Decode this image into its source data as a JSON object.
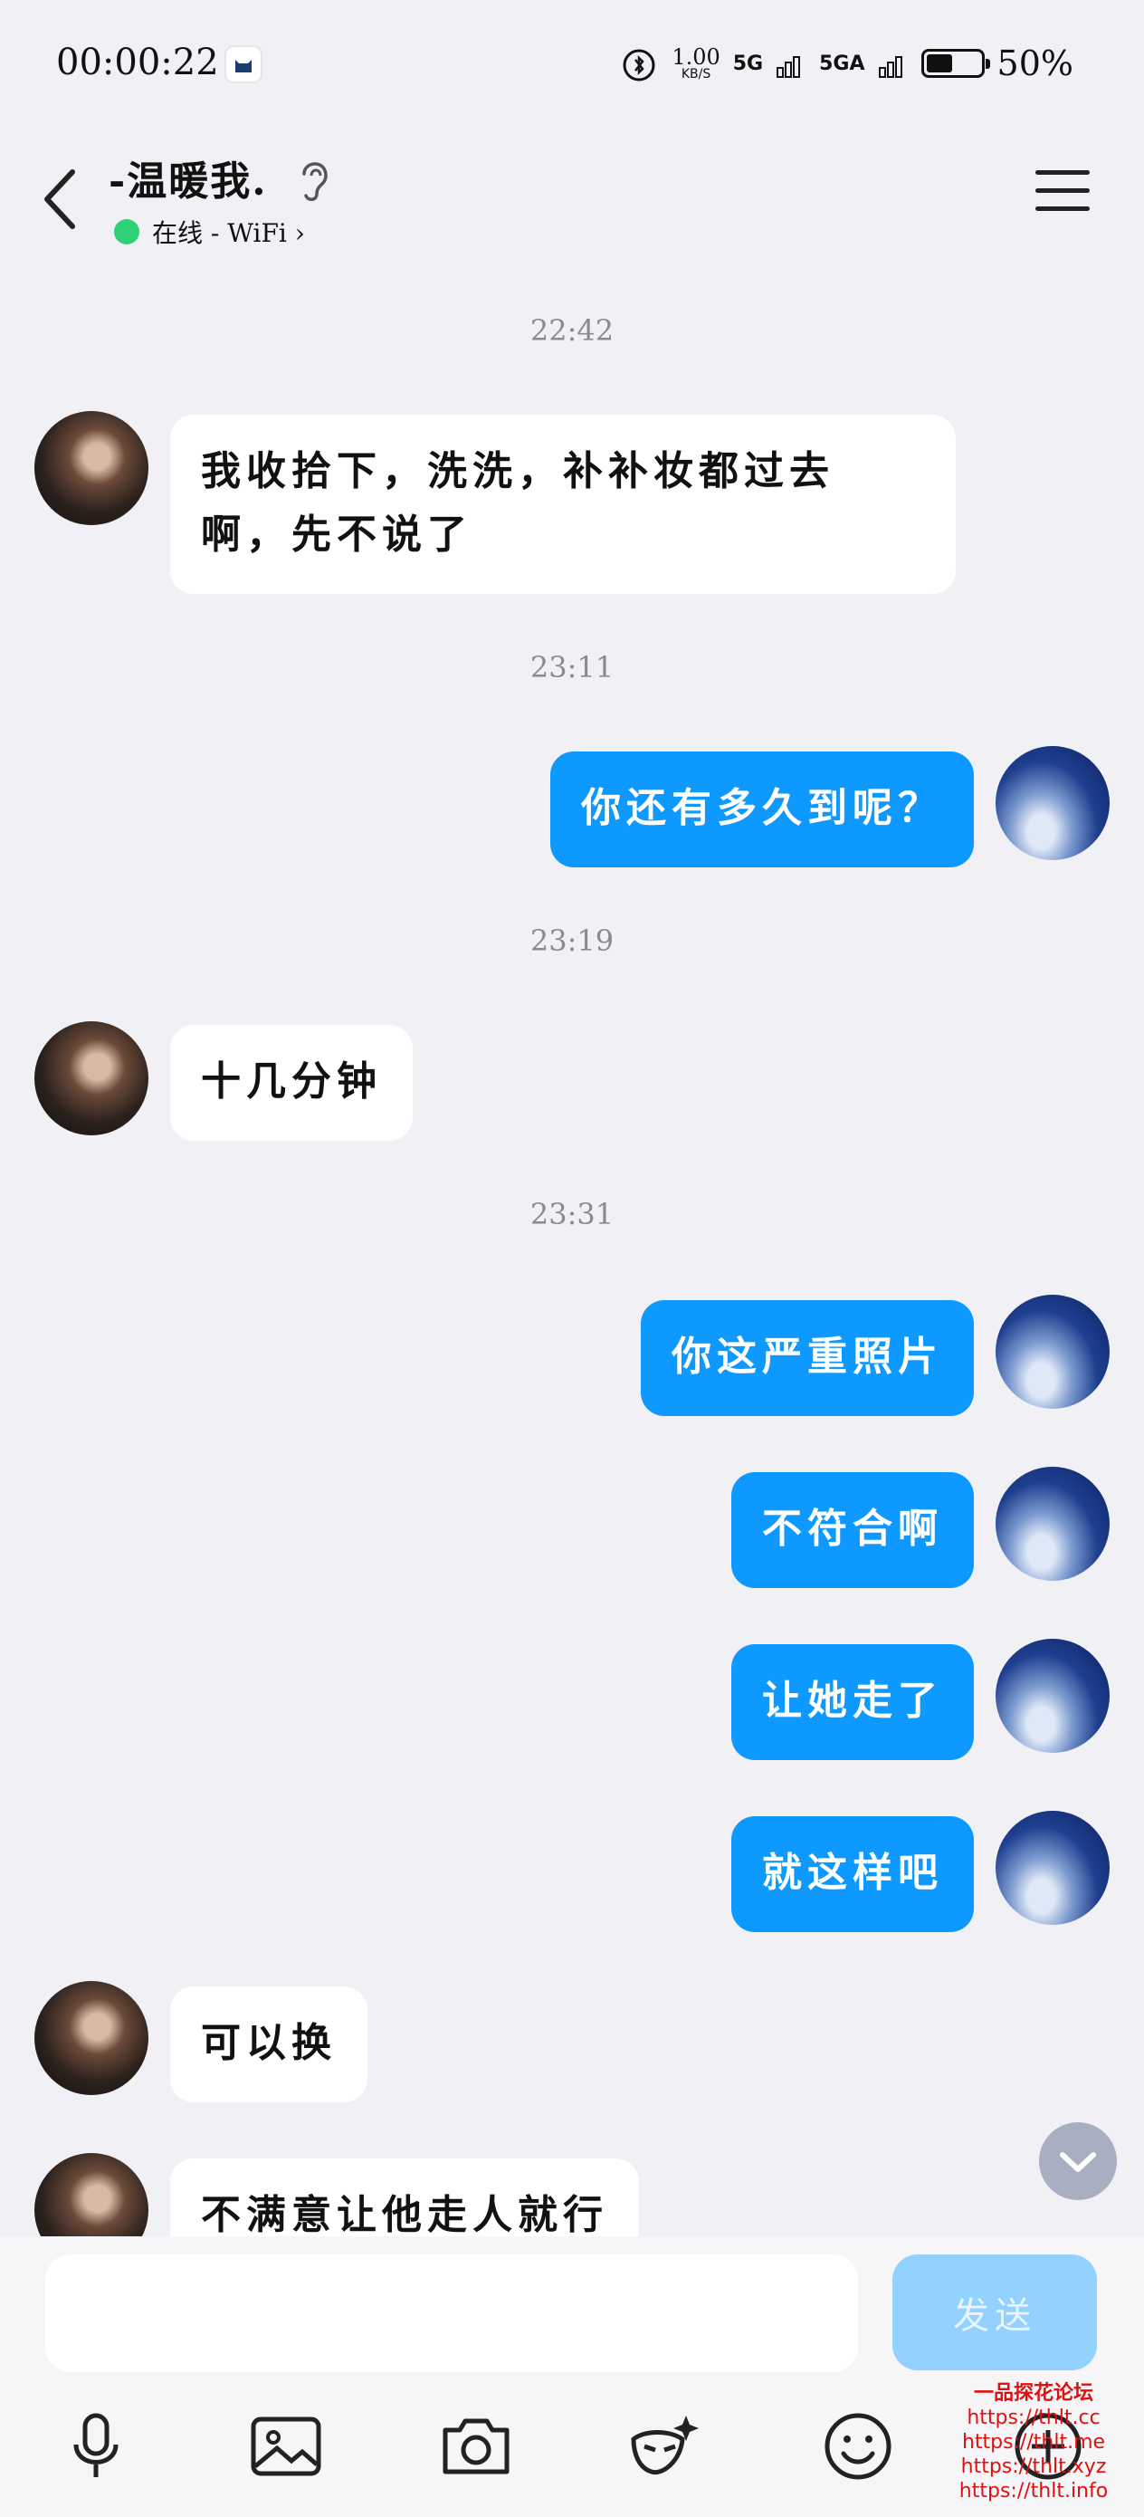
{
  "status_bar": {
    "time": "00:00:22",
    "speed_value": "1.00",
    "speed_unit": "KB/S",
    "net1": "5G",
    "net2": "5GA",
    "battery_pct": "50%",
    "battery_level": 0.5
  },
  "header": {
    "contact_name": "-温暖我.",
    "status": "在线 - WiFi",
    "status_color": "#2fd177"
  },
  "messages": [
    {
      "type": "time",
      "text": "22:42"
    },
    {
      "type": "in",
      "text": "我收拾下，洗洗，补补妆都过去"
    },
    {
      "type": "in_cont",
      "text": "啊，先不说了"
    },
    {
      "type": "time",
      "text": "23:11"
    },
    {
      "type": "out",
      "text": "你还有多久到呢？"
    },
    {
      "type": "time",
      "text": "23:19"
    },
    {
      "type": "in",
      "text": "十几分钟"
    },
    {
      "type": "time",
      "text": "23:31"
    },
    {
      "type": "out",
      "text": "你这严重照片"
    },
    {
      "type": "out",
      "text": "不符合啊"
    },
    {
      "type": "out",
      "text": "让她走了"
    },
    {
      "type": "out",
      "text": "就这样吧"
    },
    {
      "type": "in",
      "text": "可以换"
    },
    {
      "type": "in",
      "text": "不满意让他走人就行"
    }
  ],
  "input": {
    "placeholder": "",
    "send_label": "发送"
  },
  "colors": {
    "outgoing_bubble": "#0d99ff",
    "incoming_bubble": "#ffffff",
    "background": "#f0f0f5"
  },
  "watermark": [
    "一品探花论坛",
    "https://thlt.cc",
    "https://thlt.me",
    "https://thlt.xyz",
    "https://thlt.info"
  ]
}
